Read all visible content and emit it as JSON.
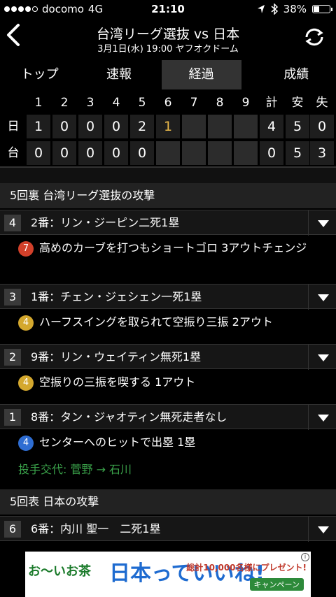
{
  "status_bar": {
    "carrier": "docomo",
    "network": "4G",
    "time": "21:10",
    "battery": "38%",
    "battery_level": 0.38
  },
  "header": {
    "title": "台湾リーグ選抜 vs 日本",
    "subtitle": "3月1日(水) 19:00 ヤフオクドーム"
  },
  "tabs": [
    "トップ",
    "速報",
    "経過",
    "成績"
  ],
  "active_tab": "経過",
  "scoreboard": {
    "columns": [
      "1",
      "2",
      "3",
      "4",
      "5",
      "6",
      "7",
      "8",
      "9",
      "計",
      "安",
      "失"
    ],
    "teams": [
      {
        "name": "日",
        "scores": [
          "1",
          "0",
          "0",
          "0",
          "2",
          "1",
          "",
          "",
          "",
          "4",
          "5",
          "0"
        ]
      },
      {
        "name": "台",
        "scores": [
          "0",
          "0",
          "0",
          "0",
          "0",
          "",
          "",
          "",
          "",
          "0",
          "5",
          "3"
        ]
      }
    ]
  },
  "innings": [
    {
      "header": "5回裏 台湾リーグ選抜の攻撃",
      "at_bats": [
        {
          "order": "4",
          "batter": "2番：リン・ジーピン二死1塁",
          "play_badge": "7",
          "badge_color": "#d2402a",
          "play": "高めのカーブを打つもショートゴロ 3アウトチェンジ"
        },
        {
          "order": "3",
          "batter": "1番：チェン・ジェシェン一死1塁",
          "play_badge": "4",
          "badge_color": "#d4a82e",
          "play": "ハーフスイングを取られて空振り三振 2アウト"
        },
        {
          "order": "2",
          "batter": "9番：リン・ウェイティン無死1塁",
          "play_badge": "4",
          "badge_color": "#d4a82e",
          "play": "空振りの三振を喫する 1アウト"
        },
        {
          "order": "1",
          "batter": "8番：タン・ジャオティン無死走者なし",
          "play_badge": "4",
          "badge_color": "#2e6dd2",
          "play": "センターへのヒットで出塁 1塁"
        }
      ],
      "pitcher_change": "投手交代: 菅野 → 石川"
    },
    {
      "header": "5回表 日本の攻撃",
      "at_bats": [
        {
          "order": "6",
          "batter": "6番：内川 聖一　二死1塁"
        }
      ]
    }
  ],
  "ad": {
    "left_text": "お〜いお茶",
    "main_text": "日本っていいね!",
    "promo_text": "総計10,000名様にプレゼント!",
    "campaign": "キャンペーン",
    "info": "i"
  }
}
